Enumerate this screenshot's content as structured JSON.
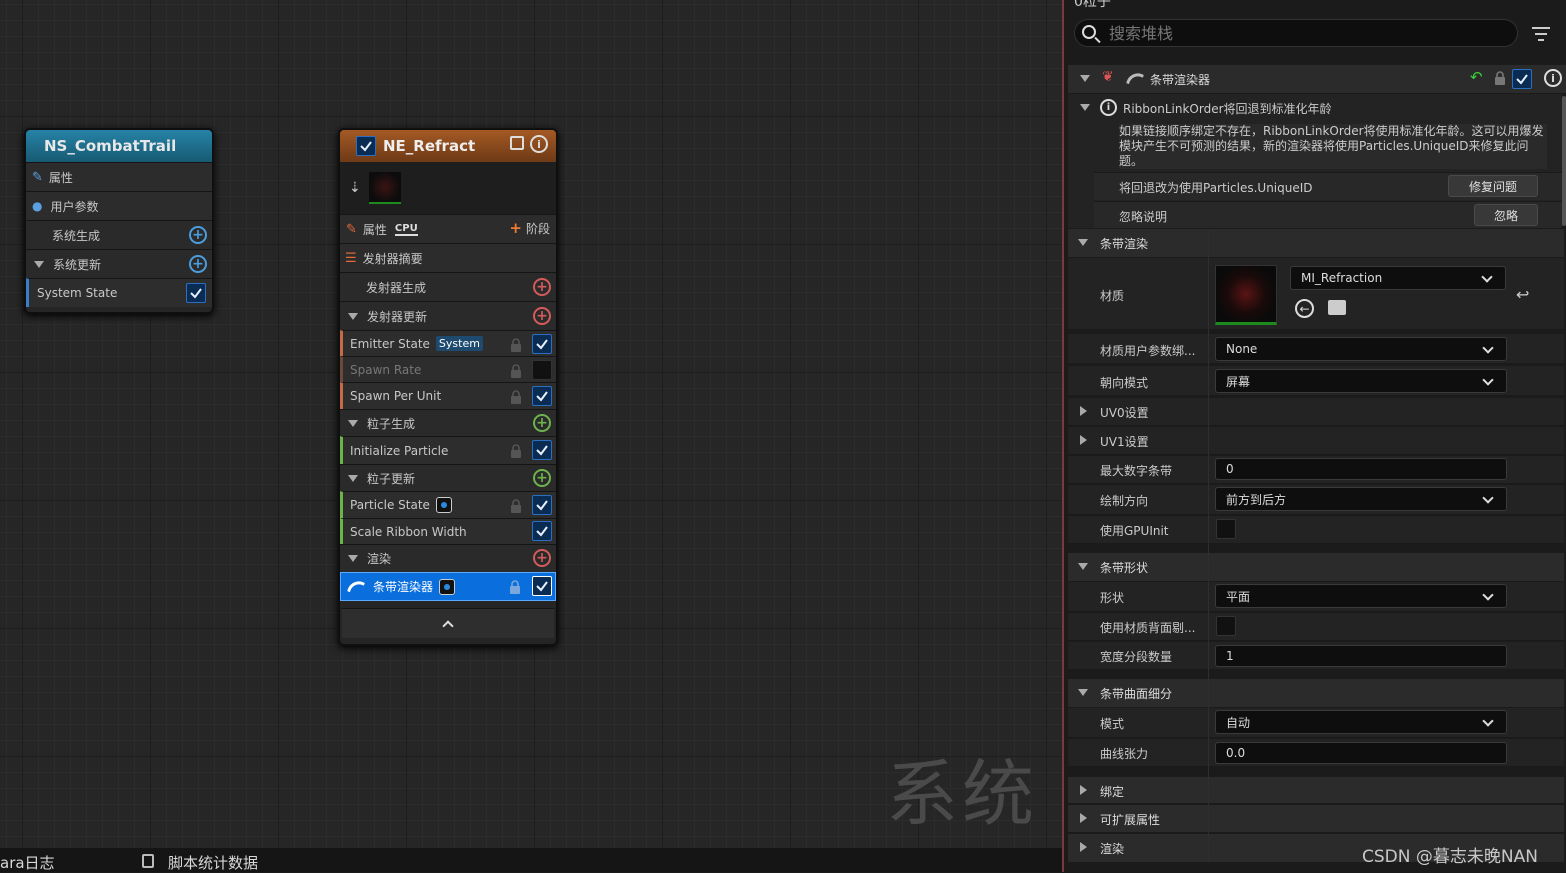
{
  "panel_header_partial": "0粒子",
  "search": {
    "placeholder": "搜索堆栈"
  },
  "stack_header": {
    "title": "条带渲染器"
  },
  "warning": {
    "title": "RibbonLinkOrder将回退到标准化年龄",
    "message": "如果链接顺序绑定不存在，RibbonLinkOrder将使用标准化年龄。这可以用爆发模块产生不可预测的结果，新的渲染器将使用Particles.UniqueID来修复此问题。",
    "fix_label": "将回退改为使用Particles.UniqueID",
    "fix_button": "修复问题",
    "ignore_label": "忽略说明",
    "ignore_button": "忽略"
  },
  "sections": {
    "ribbon_render": "条带渲染",
    "ribbon_shape": "条带形状",
    "ribbon_tess": "条带曲面细分",
    "bindings": "绑定",
    "extensible": "可扩展属性",
    "rendering": "渲染"
  },
  "props": {
    "material": "材质",
    "material_value": "MI_Refraction",
    "mat_user_param": "材质用户参数绑...",
    "mat_user_param_value": "None",
    "facing": "朝向模式",
    "facing_value": "屏幕",
    "uv0": "UV0设置",
    "uv1": "UV1设置",
    "max_ribbons": "最大数字条带",
    "max_ribbons_value": "0",
    "draw_dir": "绘制方向",
    "draw_dir_value": "前方到后方",
    "use_gpu_init": "使用GPUInit",
    "shape": "形状",
    "shape_value": "平面",
    "use_mat_backface": "使用材质背面剔...",
    "width_segments": "宽度分段数量",
    "width_segments_value": "1",
    "tess_mode": "模式",
    "tess_mode_value": "自动",
    "curve_tension": "曲线张力",
    "curve_tension_value": "0.0"
  },
  "system_node": {
    "title": "NS_CombatTrail",
    "rows": [
      "属性",
      "用户参数",
      "系统生成",
      "系统更新",
      "System State"
    ]
  },
  "emitter_node": {
    "title": "NE_Refract",
    "properties": "属性",
    "cpu": "CPU",
    "stage": "阶段",
    "summary": "发射器摘要",
    "emitter_spawn": "发射器生成",
    "emitter_update": "发射器更新",
    "emitter_state": "Emitter State",
    "system_badge": "System",
    "spawn_rate": "Spawn Rate",
    "spawn_per_unit": "Spawn Per Unit",
    "particle_spawn": "粒子生成",
    "init_particle": "Initialize Particle",
    "particle_update": "粒子更新",
    "particle_state": "Particle State",
    "scale_ribbon": "Scale Ribbon Width",
    "render": "渲染",
    "ribbon_renderer": "条带渲染器"
  },
  "watermark": "系统",
  "bottom_tabs": {
    "log": "ara日志",
    "script_stats": "脚本统计数据"
  },
  "credit": "CSDN @暮志未晚NAN",
  "colors": {
    "system_header": "#1f6a86",
    "emitter_header": "#8a4a1e",
    "accent": "#0070e0",
    "emitter_spawn_plus": "#d45b5b",
    "particle_plus": "#6db34c"
  }
}
